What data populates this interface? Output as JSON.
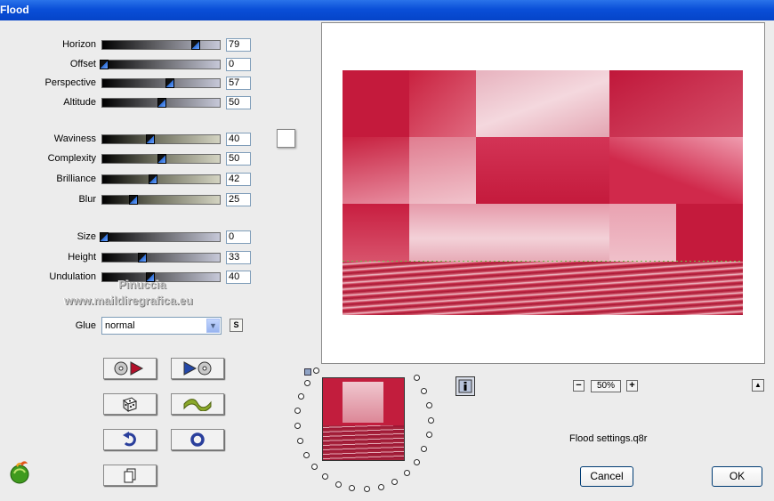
{
  "window": {
    "title": "Flood"
  },
  "sliders": [
    {
      "label": "Horizon",
      "value": 79,
      "style": "dark"
    },
    {
      "label": "Offset",
      "value": 0,
      "style": "dark"
    },
    {
      "label": "Perspective",
      "value": 57,
      "style": "dark"
    },
    {
      "label": "Altitude",
      "value": 50,
      "style": "dark"
    },
    {
      "label": "Waviness",
      "value": 40,
      "style": "olive"
    },
    {
      "label": "Complexity",
      "value": 50,
      "style": "olive"
    },
    {
      "label": "Brilliance",
      "value": 42,
      "style": "olive"
    },
    {
      "label": "Blur",
      "value": 25,
      "style": "olive"
    },
    {
      "label": "Size",
      "value": 0,
      "style": "dark"
    },
    {
      "label": "Height",
      "value": 33,
      "style": "dark"
    },
    {
      "label": "Undulation",
      "value": 40,
      "style": "dark"
    }
  ],
  "flood_color": "#ffffff",
  "watermark": {
    "line1": "Pinuccia",
    "line2": "www.maildiregrafica.eu"
  },
  "glue": {
    "label": "Glue",
    "selected": "normal",
    "s_button": "S"
  },
  "tool_buttons": [
    {
      "name": "load-preset-button",
      "icon": "disk-play-icon"
    },
    {
      "name": "save-preset-button",
      "icon": "play-disk-icon"
    },
    {
      "name": "randomize-button",
      "icon": "dice-icon"
    },
    {
      "name": "wave-button",
      "icon": "wave-icon"
    },
    {
      "name": "undo-button",
      "icon": "undo-arrow-icon"
    },
    {
      "name": "reset-button",
      "icon": "ring-icon"
    },
    {
      "name": "copy-button",
      "icon": "pages-icon"
    }
  ],
  "preview": {
    "zoom_level": "50%",
    "zoom_minus": "−",
    "zoom_plus": "+",
    "collapse": "▲"
  },
  "colors": {
    "crimson": "#c41a3c",
    "light_pink": "#e7b2be",
    "title_blue": "#0a4fd8"
  },
  "settings_file": "Flood settings.q8r",
  "buttons": {
    "cancel": "Cancel",
    "ok": "OK"
  }
}
